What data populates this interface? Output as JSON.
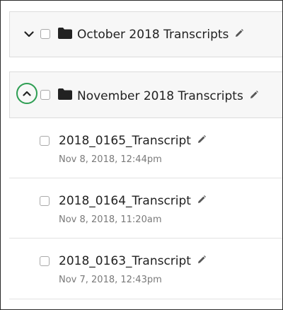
{
  "folders": [
    {
      "title": "October 2018 Transcripts",
      "state": "collapsed",
      "toggle_icon": "chevron-down-icon"
    },
    {
      "title": "November 2018 Transcripts",
      "state": "expanded",
      "toggle_icon": "chevron-up-icon",
      "items": [
        {
          "name": "2018_0165_Transcript",
          "date": "Nov 8, 2018, 12:44pm"
        },
        {
          "name": "2018_0164_Transcript",
          "date": "Nov 8, 2018, 11:20am"
        },
        {
          "name": "2018_0163_Transcript",
          "date": "Nov 7, 2018, 12:43pm"
        }
      ]
    }
  ],
  "colors": {
    "highlight_ring": "#2e9e53",
    "folder_row_bg": "#f7f7f7",
    "date_text": "#7a7a7a",
    "border": "#dcdcdc"
  }
}
